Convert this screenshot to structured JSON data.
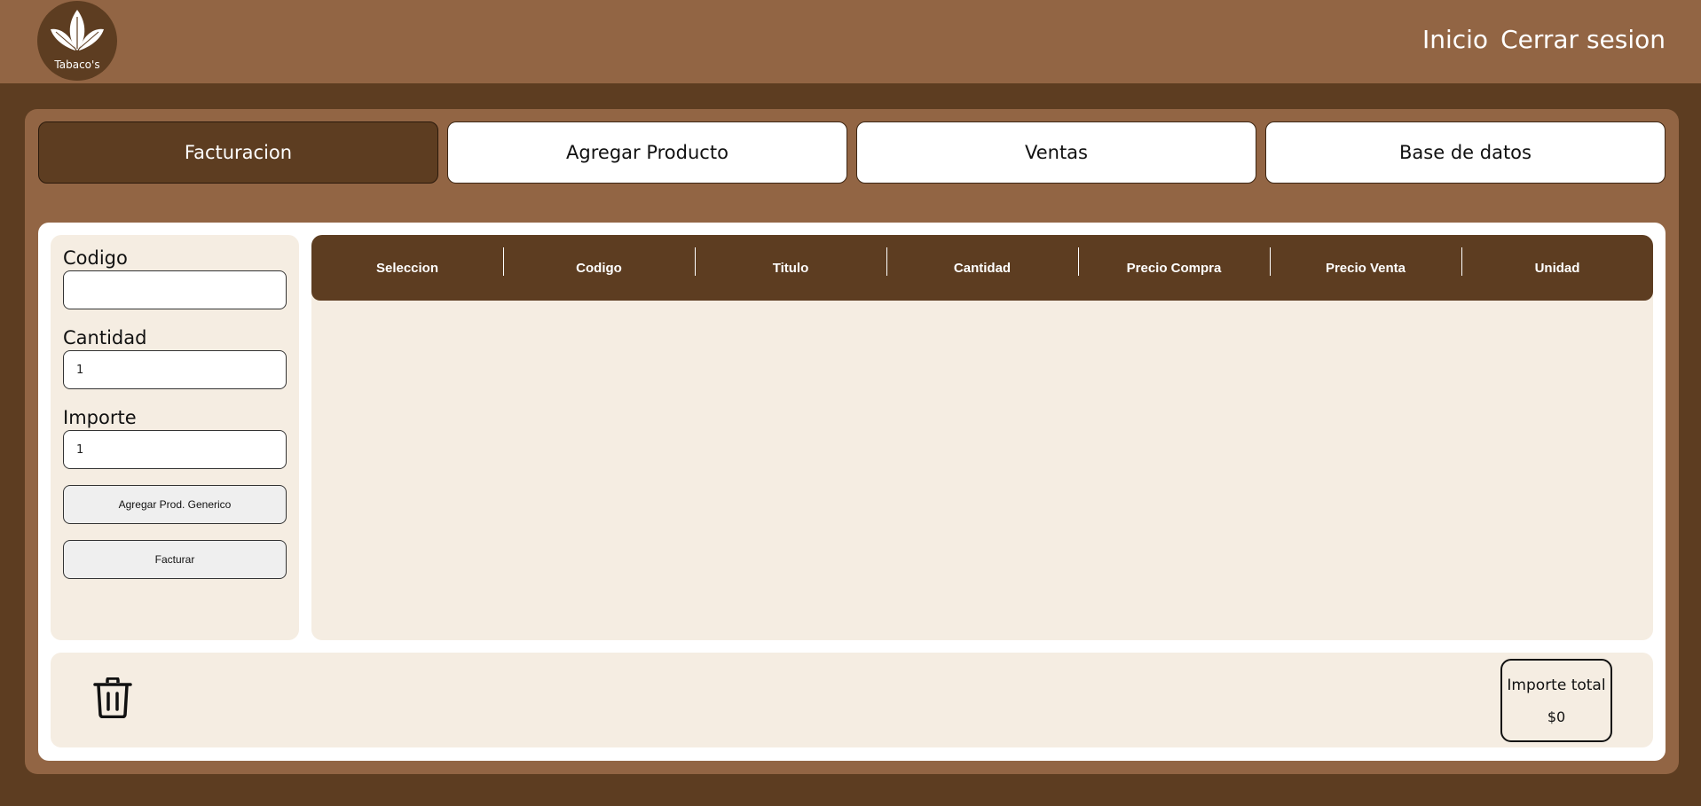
{
  "header": {
    "logo_text": "Tabaco's",
    "nav": {
      "inicio": "Inicio",
      "cerrar_sesion": "Cerrar sesion"
    }
  },
  "tabs": [
    {
      "label": "Facturacion",
      "active": true
    },
    {
      "label": "Agregar Producto",
      "active": false
    },
    {
      "label": "Ventas",
      "active": false
    },
    {
      "label": "Base de datos",
      "active": false
    }
  ],
  "form": {
    "codigo_label": "Codigo",
    "codigo_value": "",
    "cantidad_label": "Cantidad",
    "cantidad_value": "1",
    "importe_label": "Importe",
    "importe_value": "1",
    "generic_button": "Agregar Prod. Generico",
    "facturar_button": "Facturar"
  },
  "table": {
    "columns": [
      "Seleccion",
      "Codigo",
      "Titulo",
      "Cantidad",
      "Precio Compra",
      "Precio Venta",
      "Unidad"
    ],
    "rows": []
  },
  "footer": {
    "trash_icon": "trash-icon",
    "total_label": "Importe total",
    "total_value": "$0"
  },
  "colors": {
    "header_bg": "#926544",
    "page_bg": "#5d3d21",
    "accent_dark": "#5d3d21",
    "panel_light": "#f5ede2"
  }
}
